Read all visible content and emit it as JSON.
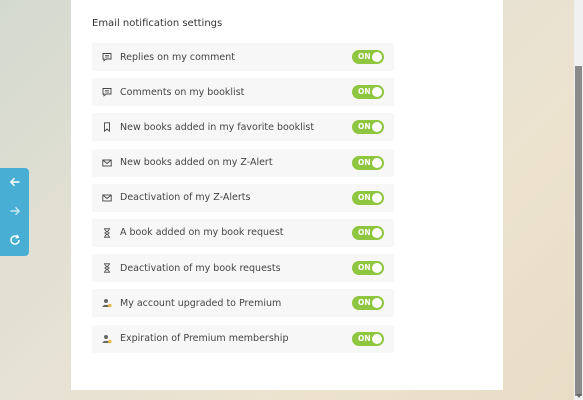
{
  "settings": {
    "section_title": "Email notification settings",
    "items": [
      {
        "label": "Replies on my comment",
        "icon": "comment-icon",
        "toggle": "ON"
      },
      {
        "label": "Comments on my booklist",
        "icon": "comment-icon",
        "toggle": "ON"
      },
      {
        "label": "New books added in my favorite booklist",
        "icon": "bookmark-icon",
        "toggle": "ON"
      },
      {
        "label": "New books added on my Z-Alert",
        "icon": "envelope-icon",
        "toggle": "ON"
      },
      {
        "label": "Deactivation of my Z-Alerts",
        "icon": "envelope-icon",
        "toggle": "ON"
      },
      {
        "label": "A book added on my book request",
        "icon": "hourglass-icon",
        "toggle": "ON"
      },
      {
        "label": "Deactivation of my book requests",
        "icon": "hourglass-icon",
        "toggle": "ON"
      },
      {
        "label": "My account upgraded to Premium",
        "icon": "user-premium-icon",
        "toggle": "ON"
      },
      {
        "label": "Expiration of Premium membership",
        "icon": "user-premium-icon",
        "toggle": "ON"
      }
    ]
  },
  "side_nav": {
    "buttons": [
      "back-arrow-icon",
      "forward-arrow-icon",
      "refresh-icon"
    ]
  },
  "colors": {
    "toggle_on": "#8fc63f",
    "nav_accent": "#49aed4"
  }
}
